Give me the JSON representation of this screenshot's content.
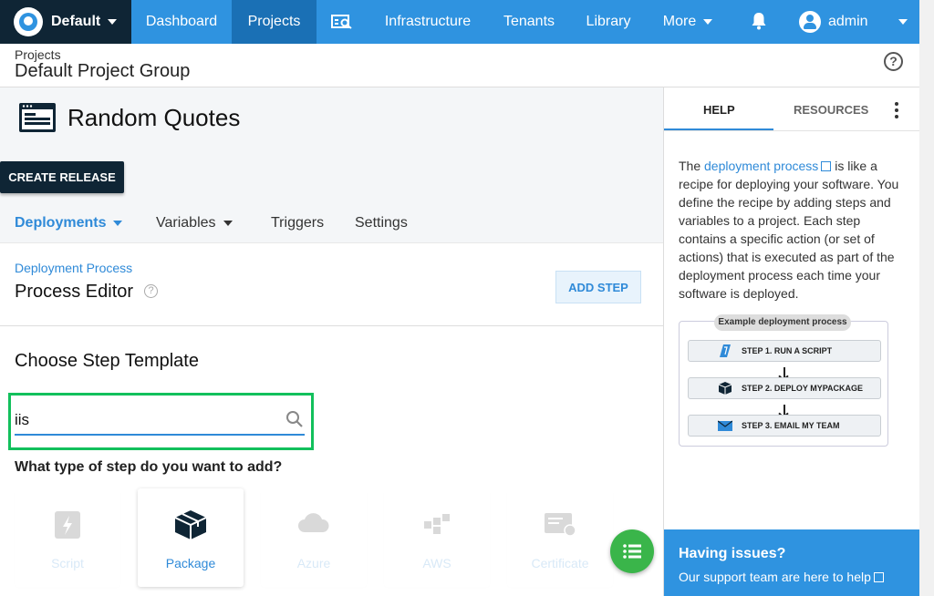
{
  "topnav": {
    "space": "Default",
    "items": [
      "Dashboard",
      "Projects",
      "Infrastructure",
      "Tenants",
      "Library",
      "More"
    ],
    "active": "Projects",
    "user": "admin"
  },
  "breadcrumb": {
    "parent": "Projects",
    "title": "Default Project Group"
  },
  "project": {
    "name": "Random Quotes",
    "create_release": "CREATE RELEASE"
  },
  "tabs": [
    "Deployments",
    "Variables",
    "Triggers",
    "Settings"
  ],
  "editor": {
    "link": "Deployment Process",
    "title": "Process Editor",
    "add_step": "ADD STEP",
    "choose": "Choose Step Template",
    "search_value": "iis",
    "question": "What type of step do you want to add?"
  },
  "step_types": [
    "Script",
    "Package",
    "Azure",
    "AWS",
    "Certificate"
  ],
  "side": {
    "tabs": [
      "HELP",
      "RESOURCES"
    ],
    "help_pre": "The ",
    "help_link": "deployment process",
    "help_post": " is like a recipe for deploying your software. You define the recipe by adding steps and variables to a project. Each step contains a specific action (or set of actions) that is executed as part of the deployment process each time your software is deployed.",
    "diagram_title": "Example deployment process",
    "diagram_steps": [
      "STEP 1. RUN A SCRIPT",
      "STEP 2. DEPLOY MYPACKAGE",
      "STEP 3. EMAIL MY TEAM"
    ],
    "issues_title": "Having issues?",
    "issues_text": "Our support team are here to help"
  },
  "colors": {
    "nav": "#2f93e0",
    "nav_active": "#1a70b5",
    "dark": "#0f2535",
    "link": "#2f8ad8",
    "highlight": "#12c05c",
    "fab": "#3ab54a"
  },
  "icons": [
    "octopus-logo",
    "bell-icon",
    "user-avatar",
    "help-icon",
    "search-icon",
    "package-icon",
    "script-icon",
    "azure-icon",
    "aws-icon",
    "certificate-icon",
    "list-icon",
    "external-link-icon",
    "kebab-icon"
  ]
}
